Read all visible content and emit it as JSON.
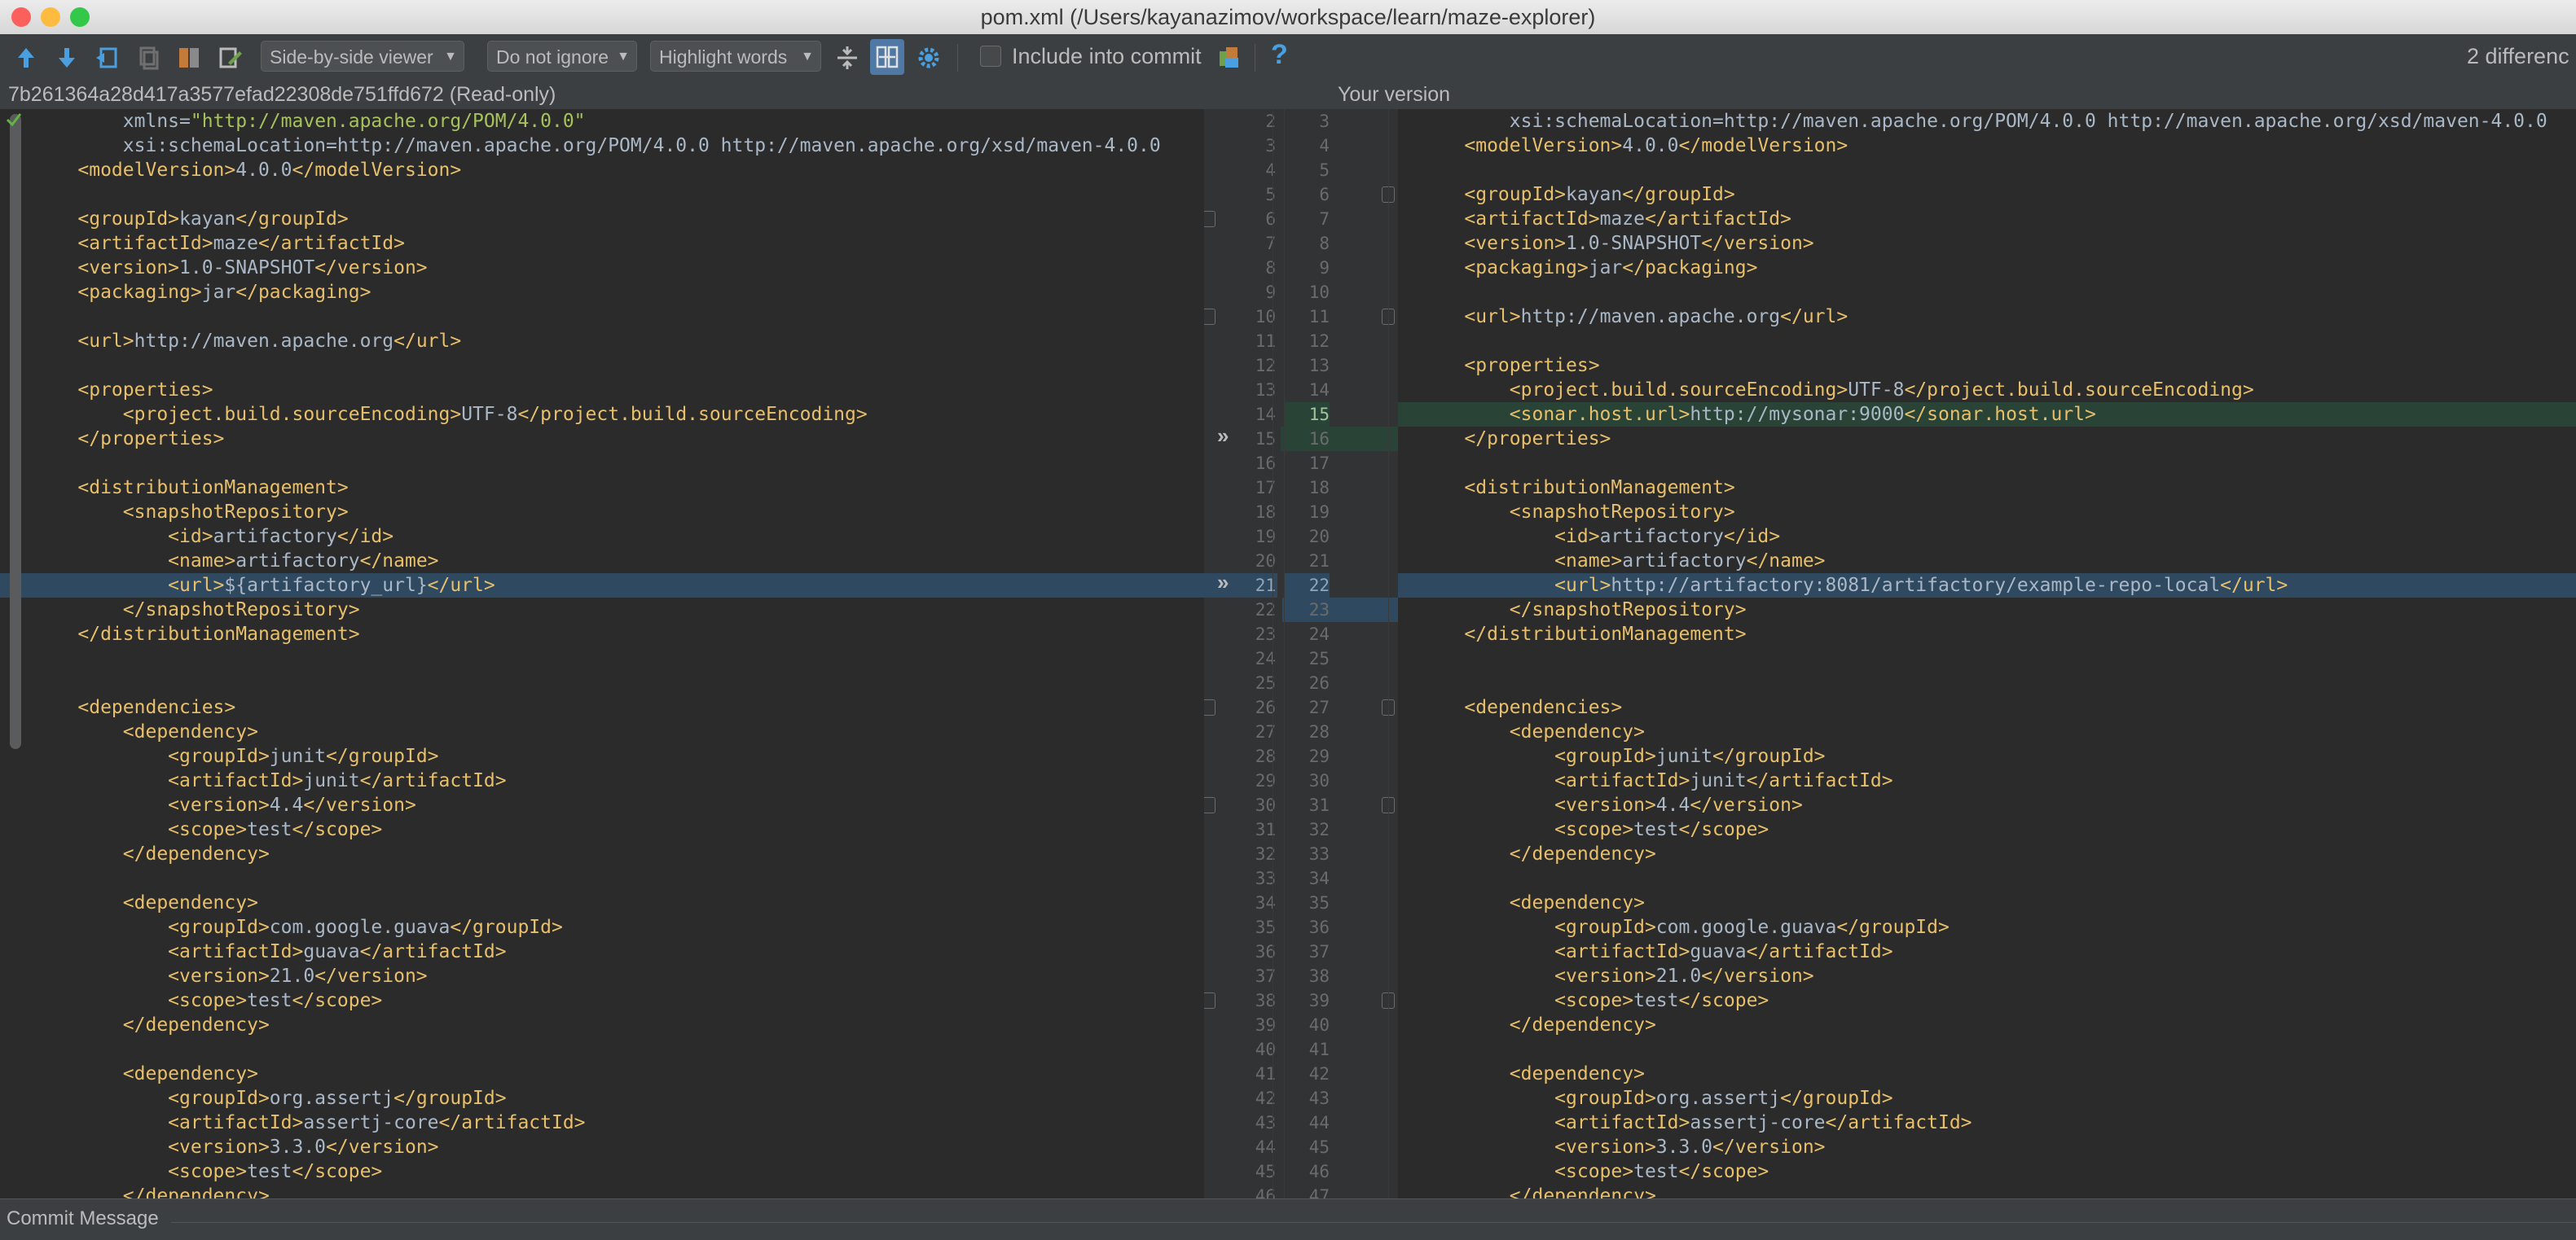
{
  "window": {
    "title": "pom.xml (/Users/kayanazimov/workspace/learn/maze-explorer)",
    "traffic_lights": [
      "#fc605c",
      "#fdbc40",
      "#34c84a"
    ]
  },
  "toolbar": {
    "icons": [
      "up-arrow-icon",
      "down-arrow-icon",
      "jump-to-source-icon",
      "copy-icon",
      "compare-icon",
      "edit-icon"
    ],
    "viewer_label": "Side-by-side viewer",
    "ignore_label": "Do not ignore",
    "highlight_label": "Highlight words",
    "include_commit_label": "Include into commit",
    "help_label": "?",
    "differences_label": "2 differenc"
  },
  "panels": {
    "left_header": "7b261364a28d417a3577efad22308de751ffd672 (Read-only)",
    "right_header": "Your version"
  },
  "left_lines": [
    {
      "n": "2",
      "text": "        xmlns=\"http://maven.apache.org/POM/4.0.0\""
    },
    {
      "n": "3",
      "text": "        xsi:schemaLocation=\"http://maven.apache.org/POM/4.0.0 http://maven.apache.org/xsd/maven-4.0.0"
    },
    {
      "n": "4",
      "text": "    <modelVersion>4.0.0</modelVersion>"
    },
    {
      "n": "5",
      "text": ""
    },
    {
      "n": "6",
      "text": "    <groupId>kayan</groupId>"
    },
    {
      "n": "7",
      "text": "    <artifactId>maze</artifactId>"
    },
    {
      "n": "8",
      "text": "    <version>1.0-SNAPSHOT</version>"
    },
    {
      "n": "9",
      "text": "    <packaging>jar</packaging>"
    },
    {
      "n": "10",
      "text": ""
    },
    {
      "n": "11",
      "text": "    <url>http://maven.apache.org</url>"
    },
    {
      "n": "12",
      "text": ""
    },
    {
      "n": "13",
      "text": "    <properties>"
    },
    {
      "n": "14",
      "text": "        <project.build.sourceEncoding>UTF-8</project.build.sourceEncoding>"
    },
    {
      "n": "15",
      "text": "    </properties>"
    },
    {
      "n": "16",
      "text": ""
    },
    {
      "n": "17",
      "text": "    <distributionManagement>"
    },
    {
      "n": "18",
      "text": "        <snapshotRepository>"
    },
    {
      "n": "19",
      "text": "            <id>artifactory</id>"
    },
    {
      "n": "20",
      "text": "            <name>artifactory</name>"
    },
    {
      "n": "21",
      "text": "            <url>${artifactory_url}</url>"
    },
    {
      "n": "22",
      "text": "        </snapshotRepository>"
    },
    {
      "n": "23",
      "text": "    </distributionManagement>"
    },
    {
      "n": "24",
      "text": ""
    },
    {
      "n": "25",
      "text": ""
    },
    {
      "n": "26",
      "text": "    <dependencies>"
    },
    {
      "n": "27",
      "text": "        <dependency>"
    },
    {
      "n": "28",
      "text": "            <groupId>junit</groupId>"
    },
    {
      "n": "29",
      "text": "            <artifactId>junit</artifactId>"
    },
    {
      "n": "30",
      "text": "            <version>4.4</version>"
    },
    {
      "n": "31",
      "text": "            <scope>test</scope>"
    },
    {
      "n": "32",
      "text": "        </dependency>"
    },
    {
      "n": "33",
      "text": ""
    },
    {
      "n": "34",
      "text": "        <dependency>"
    },
    {
      "n": "35",
      "text": "            <groupId>com.google.guava</groupId>"
    },
    {
      "n": "36",
      "text": "            <artifactId>guava</artifactId>"
    },
    {
      "n": "37",
      "text": "            <version>21.0</version>"
    },
    {
      "n": "38",
      "text": "            <scope>test</scope>"
    },
    {
      "n": "39",
      "text": "        </dependency>"
    },
    {
      "n": "40",
      "text": ""
    },
    {
      "n": "41",
      "text": "        <dependency>"
    },
    {
      "n": "42",
      "text": "            <groupId>org.assertj</groupId>"
    },
    {
      "n": "43",
      "text": "            <artifactId>assertj-core</artifactId>"
    },
    {
      "n": "44",
      "text": "            <version>3.3.0</version>"
    },
    {
      "n": "45",
      "text": "            <scope>test</scope>"
    },
    {
      "n": "46",
      "text": "        </dependency>"
    }
  ],
  "right_lines": [
    {
      "n": "3",
      "text": "        xsi:schemaLocation=\"http://maven.apache.org/POM/4.0.0 http://maven.apache.org/xsd/maven-4.0.0"
    },
    {
      "n": "4",
      "text": "    <modelVersion>4.0.0</modelVersion>"
    },
    {
      "n": "5",
      "text": ""
    },
    {
      "n": "6",
      "text": "    <groupId>kayan</groupId>"
    },
    {
      "n": "7",
      "text": "    <artifactId>maze</artifactId>"
    },
    {
      "n": "8",
      "text": "    <version>1.0-SNAPSHOT</version>"
    },
    {
      "n": "9",
      "text": "    <packaging>jar</packaging>"
    },
    {
      "n": "10",
      "text": ""
    },
    {
      "n": "11",
      "text": "    <url>http://maven.apache.org</url>"
    },
    {
      "n": "12",
      "text": ""
    },
    {
      "n": "13",
      "text": "    <properties>"
    },
    {
      "n": "14",
      "text": "        <project.build.sourceEncoding>UTF-8</project.build.sourceEncoding>"
    },
    {
      "n": "15",
      "text": "        <sonar.host.url>http://mysonar:9000</sonar.host.url>"
    },
    {
      "n": "16",
      "text": "    </properties>"
    },
    {
      "n": "17",
      "text": ""
    },
    {
      "n": "18",
      "text": "    <distributionManagement>"
    },
    {
      "n": "19",
      "text": "        <snapshotRepository>"
    },
    {
      "n": "20",
      "text": "            <id>artifactory</id>"
    },
    {
      "n": "21",
      "text": "            <name>artifactory</name>"
    },
    {
      "n": "22",
      "text": "            <url>http://artifactory:8081/artifactory/example-repo-local</url>"
    },
    {
      "n": "23",
      "text": "        </snapshotRepository>"
    },
    {
      "n": "24",
      "text": "    </distributionManagement>"
    },
    {
      "n": "25",
      "text": ""
    },
    {
      "n": "26",
      "text": ""
    },
    {
      "n": "27",
      "text": "    <dependencies>"
    },
    {
      "n": "28",
      "text": "        <dependency>"
    },
    {
      "n": "29",
      "text": "            <groupId>junit</groupId>"
    },
    {
      "n": "30",
      "text": "            <artifactId>junit</artifactId>"
    },
    {
      "n": "31",
      "text": "            <version>4.4</version>"
    },
    {
      "n": "32",
      "text": "            <scope>test</scope>"
    },
    {
      "n": "33",
      "text": "        </dependency>"
    },
    {
      "n": "34",
      "text": ""
    },
    {
      "n": "35",
      "text": "        <dependency>"
    },
    {
      "n": "36",
      "text": "            <groupId>com.google.guava</groupId>"
    },
    {
      "n": "37",
      "text": "            <artifactId>guava</artifactId>"
    },
    {
      "n": "38",
      "text": "            <version>21.0</version>"
    },
    {
      "n": "39",
      "text": "            <scope>test</scope>"
    },
    {
      "n": "40",
      "text": "        </dependency>"
    },
    {
      "n": "41",
      "text": ""
    },
    {
      "n": "42",
      "text": "        <dependency>"
    },
    {
      "n": "43",
      "text": "            <groupId>org.assertj</groupId>"
    },
    {
      "n": "44",
      "text": "            <artifactId>assertj-core</artifactId>"
    },
    {
      "n": "45",
      "text": "            <version>3.3.0</version>"
    },
    {
      "n": "46",
      "text": "            <scope>test</scope>"
    },
    {
      "n": "47",
      "text": "        </dependency>"
    }
  ],
  "gutter_left_numbers": [
    "2",
    "3",
    "4",
    "5",
    "6",
    "7",
    "8",
    "9",
    "10",
    "11",
    "12",
    "13",
    "14",
    "15",
    "16",
    "17",
    "18",
    "19",
    "20",
    "21",
    "22",
    "23",
    "24",
    "25",
    "26",
    "27",
    "28",
    "29",
    "30",
    "31",
    "32",
    "33",
    "34",
    "35",
    "36",
    "37",
    "38",
    "39",
    "40",
    "41",
    "42",
    "43",
    "44",
    "45",
    "46"
  ],
  "gutter_right_numbers": [
    "3",
    "4",
    "5",
    "6",
    "7",
    "8",
    "9",
    "10",
    "11",
    "12",
    "13",
    "14",
    "15",
    "16",
    "17",
    "18",
    "19",
    "20",
    "21",
    "22",
    "23",
    "24",
    "25",
    "26",
    "27",
    "28",
    "29",
    "30",
    "31",
    "32",
    "33",
    "34",
    "35",
    "36",
    "37",
    "38",
    "39",
    "40",
    "41",
    "42",
    "43",
    "44",
    "45",
    "46",
    "47"
  ],
  "changes": {
    "added_right_line": "15",
    "modified_left_line": "21",
    "modified_right_line": "22",
    "chevron_glyph": "»",
    "colors": {
      "added": "#294436",
      "modified": "#2f4a60"
    }
  },
  "commit_message_label": "Commit Message"
}
